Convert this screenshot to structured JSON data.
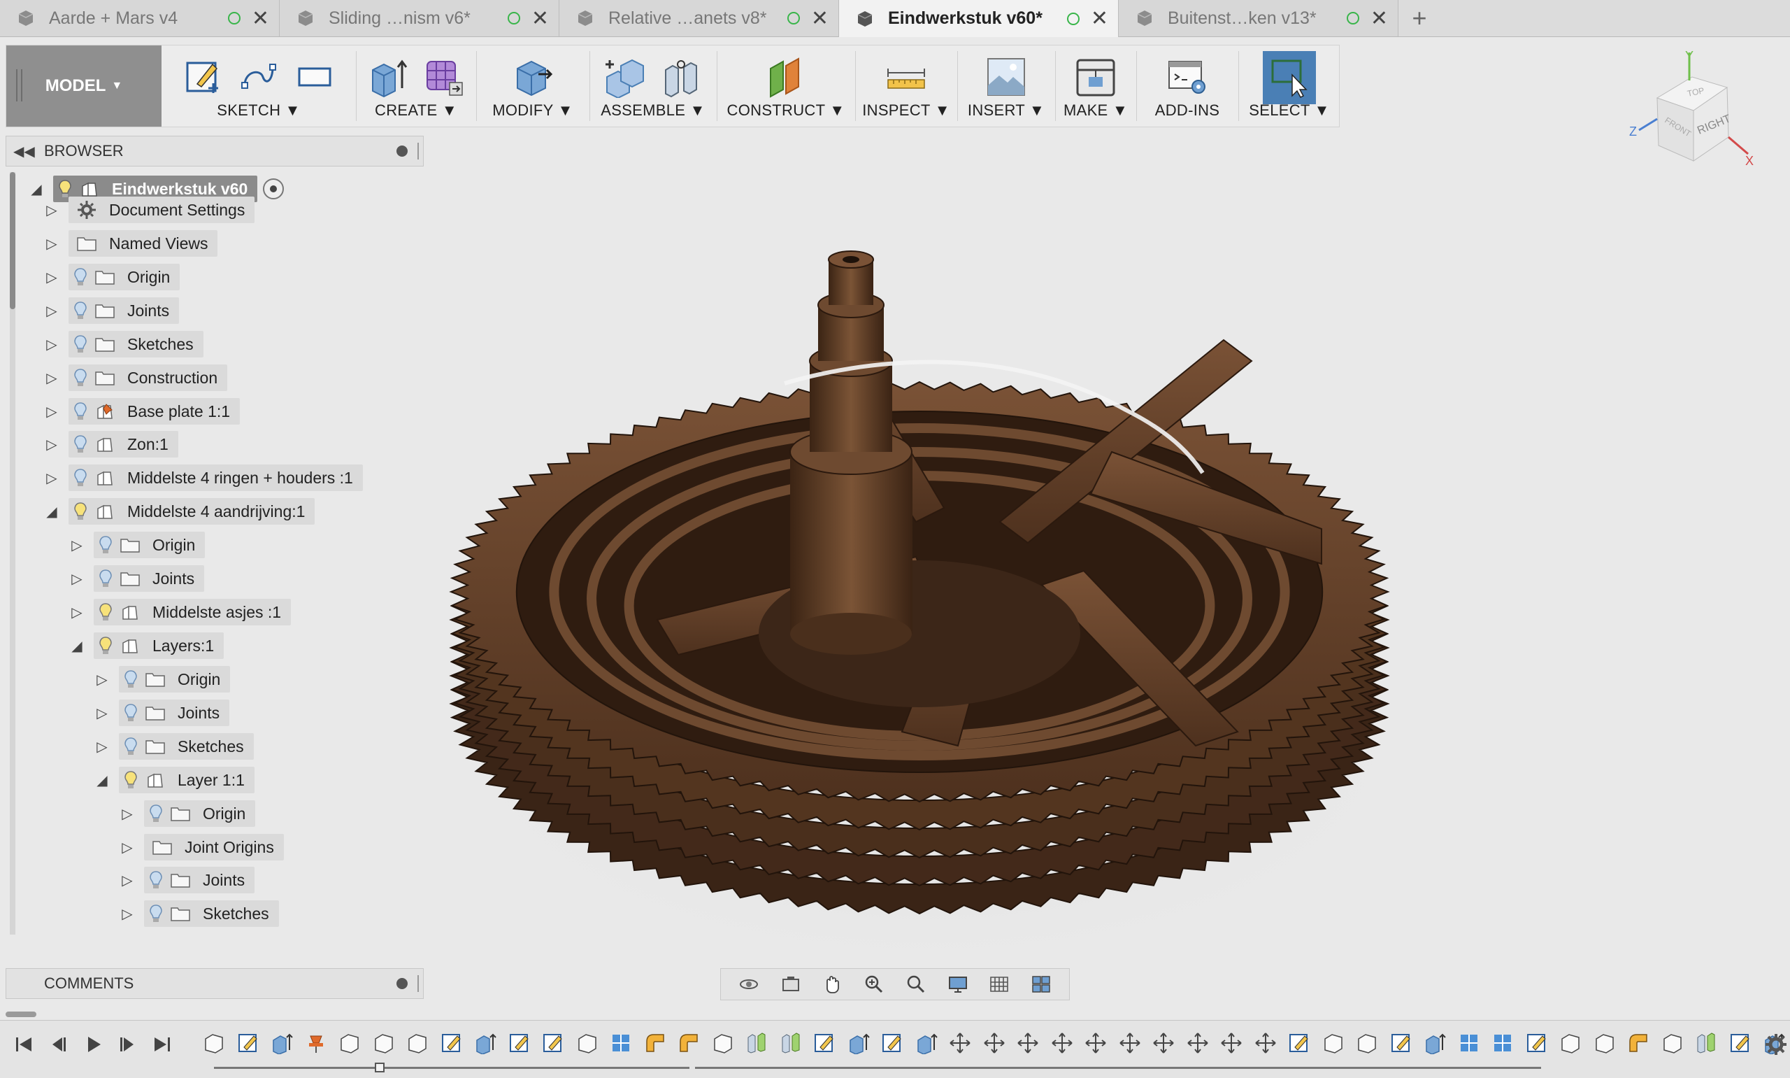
{
  "tabs": [
    {
      "label": "Aarde + Mars v4",
      "active": false
    },
    {
      "label": "Sliding …nism v6*",
      "active": false
    },
    {
      "label": "Relative …anets v8*",
      "active": false
    },
    {
      "label": "Eindwerkstuk v60*",
      "active": true
    },
    {
      "label": "Buitenst…ken v13*",
      "active": false
    }
  ],
  "new_tab_label": "+",
  "toolbar": {
    "workspace": "MODEL",
    "groups": [
      {
        "label": "SKETCH",
        "icons": [
          "create-sketch-icon",
          "spline-icon",
          "rectangle-icon"
        ]
      },
      {
        "label": "CREATE",
        "icons": [
          "extrude-icon",
          "form-icon"
        ]
      },
      {
        "label": "MODIFY",
        "icons": [
          "press-pull-icon"
        ]
      },
      {
        "label": "ASSEMBLE",
        "icons": [
          "new-component-icon",
          "joint-icon"
        ]
      },
      {
        "label": "CONSTRUCT",
        "icons": [
          "offset-plane-icon"
        ]
      },
      {
        "label": "INSPECT",
        "icons": [
          "measure-icon"
        ]
      },
      {
        "label": "INSERT",
        "icons": [
          "insert-image-icon"
        ]
      },
      {
        "label": "MAKE",
        "icons": [
          "3d-print-icon"
        ]
      },
      {
        "label": "ADD-INS",
        "icons": [
          "scripts-icon"
        ]
      },
      {
        "label": "SELECT",
        "icons": [
          "select-icon"
        ]
      }
    ]
  },
  "browser": {
    "title": "BROWSER",
    "root": "Eindwerkstuk v60",
    "items": [
      {
        "label": "Document Settings",
        "level": 1,
        "expanded": false,
        "bulb": false,
        "type": "gear"
      },
      {
        "label": "Named Views",
        "level": 1,
        "expanded": false,
        "bulb": false,
        "type": "folder"
      },
      {
        "label": "Origin",
        "level": 1,
        "expanded": false,
        "bulb": true,
        "type": "folder"
      },
      {
        "label": "Joints",
        "level": 1,
        "expanded": false,
        "bulb": true,
        "type": "folder"
      },
      {
        "label": "Sketches",
        "level": 1,
        "expanded": false,
        "bulb": true,
        "type": "folder"
      },
      {
        "label": "Construction",
        "level": 1,
        "expanded": false,
        "bulb": true,
        "type": "folder"
      },
      {
        "label": "Base plate 1:1",
        "level": 1,
        "expanded": false,
        "bulb": true,
        "type": "pinned"
      },
      {
        "label": "Zon:1",
        "level": 1,
        "expanded": false,
        "bulb": true,
        "type": "component"
      },
      {
        "label": "Middelste 4 ringen + houders :1",
        "level": 1,
        "expanded": false,
        "bulb": true,
        "type": "component"
      },
      {
        "label": "Middelste 4 aandrijving:1",
        "level": 1,
        "expanded": true,
        "bulb": true,
        "type": "component"
      },
      {
        "label": "Origin",
        "level": 2,
        "expanded": false,
        "bulb": true,
        "type": "folder"
      },
      {
        "label": "Joints",
        "level": 2,
        "expanded": false,
        "bulb": true,
        "type": "folder"
      },
      {
        "label": "Middelste asjes :1",
        "level": 2,
        "expanded": false,
        "bulb": true,
        "type": "component"
      },
      {
        "label": "Layers:1",
        "level": 2,
        "expanded": true,
        "bulb": true,
        "type": "component"
      },
      {
        "label": "Origin",
        "level": 3,
        "expanded": false,
        "bulb": true,
        "type": "folder"
      },
      {
        "label": "Joints",
        "level": 3,
        "expanded": false,
        "bulb": true,
        "type": "folder"
      },
      {
        "label": "Sketches",
        "level": 3,
        "expanded": false,
        "bulb": true,
        "type": "folder"
      },
      {
        "label": "Layer 1:1",
        "level": 3,
        "expanded": true,
        "bulb": true,
        "type": "component"
      },
      {
        "label": "Origin",
        "level": 4,
        "expanded": false,
        "bulb": true,
        "type": "folder"
      },
      {
        "label": "Joint Origins",
        "level": 4,
        "expanded": false,
        "bulb": false,
        "type": "folder"
      },
      {
        "label": "Joints",
        "level": 4,
        "expanded": false,
        "bulb": true,
        "type": "folder"
      },
      {
        "label": "Sketches",
        "level": 4,
        "expanded": false,
        "bulb": true,
        "type": "folder"
      }
    ]
  },
  "comments": {
    "title": "COMMENTS"
  },
  "viewcube": {
    "face_right": "RIGHT",
    "face_front": "FRONT",
    "face_top": "TOP",
    "axis_x": "X",
    "axis_y": "Y",
    "axis_z": "Z"
  },
  "colors": {
    "wood_dark": "#3a2416",
    "wood_mid": "#5c3b25",
    "wood_light": "#7a5236",
    "select_blue": "#4a7fb5",
    "status_green": "#39b54a"
  },
  "navbar_icons": [
    "orbit-icon",
    "look-at-icon",
    "pan-icon",
    "zoom-icon",
    "fit-icon",
    "display-settings-icon",
    "grid-icon",
    "viewports-icon"
  ],
  "timeline": {
    "controls": [
      "go-to-start-icon",
      "step-back-icon",
      "play-icon",
      "step-forward-icon",
      "go-to-end-icon"
    ],
    "features": [
      "box",
      "sketch",
      "extrude",
      "pin",
      "box",
      "box",
      "box",
      "sketch",
      "extrude",
      "sketch",
      "sketch",
      "box",
      "pattern",
      "fillet",
      "fillet",
      "box",
      "joint",
      "joint",
      "sketch",
      "extrude",
      "sketch",
      "extrude",
      "move",
      "move",
      "move",
      "move",
      "move",
      "move",
      "move",
      "move",
      "move",
      "move",
      "sketch",
      "box",
      "box",
      "sketch",
      "extrude",
      "pattern",
      "pattern",
      "sketch",
      "box",
      "box",
      "fillet",
      "box",
      "joint",
      "sketch",
      "extrude"
    ]
  }
}
